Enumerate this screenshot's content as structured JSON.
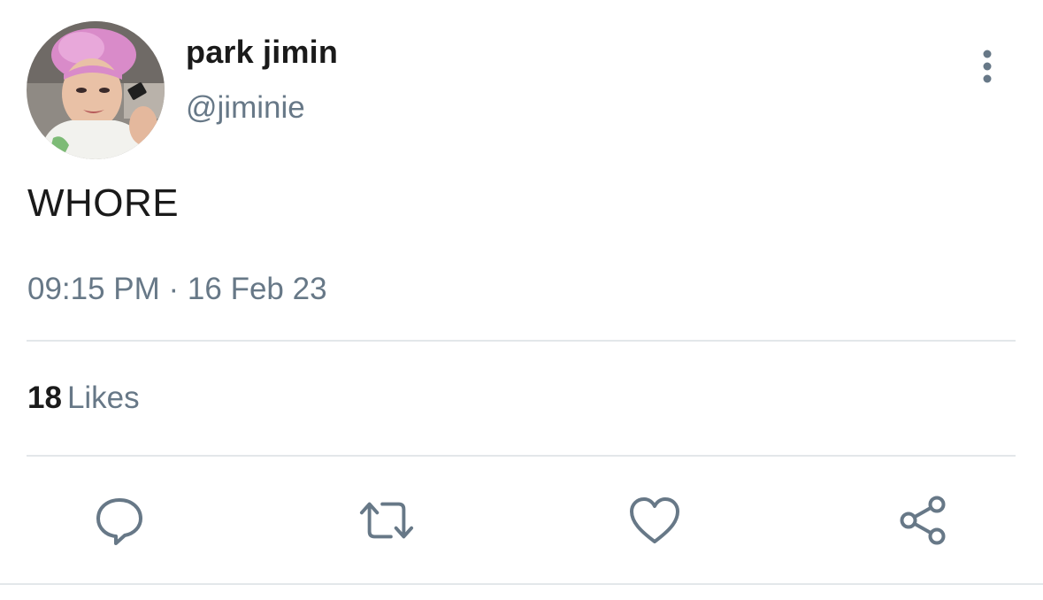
{
  "tweet": {
    "display_name": "park jimin",
    "handle": "@jiminie",
    "text": "WHORE",
    "timestamp": "09:15 PM · 16 Feb 23",
    "likes": {
      "count": "18",
      "label": "Likes"
    }
  },
  "icons": {
    "avatar": "profile-photo",
    "more": "more-vertical-icon",
    "reply": "reply-icon",
    "retweet": "retweet-icon",
    "like": "heart-icon",
    "share": "share-icon"
  },
  "colors": {
    "primary_text": "#1a1a1a",
    "secondary_text": "#677887",
    "icon": "#677887",
    "divider": "#e3e7ea",
    "background": "#ffffff"
  }
}
